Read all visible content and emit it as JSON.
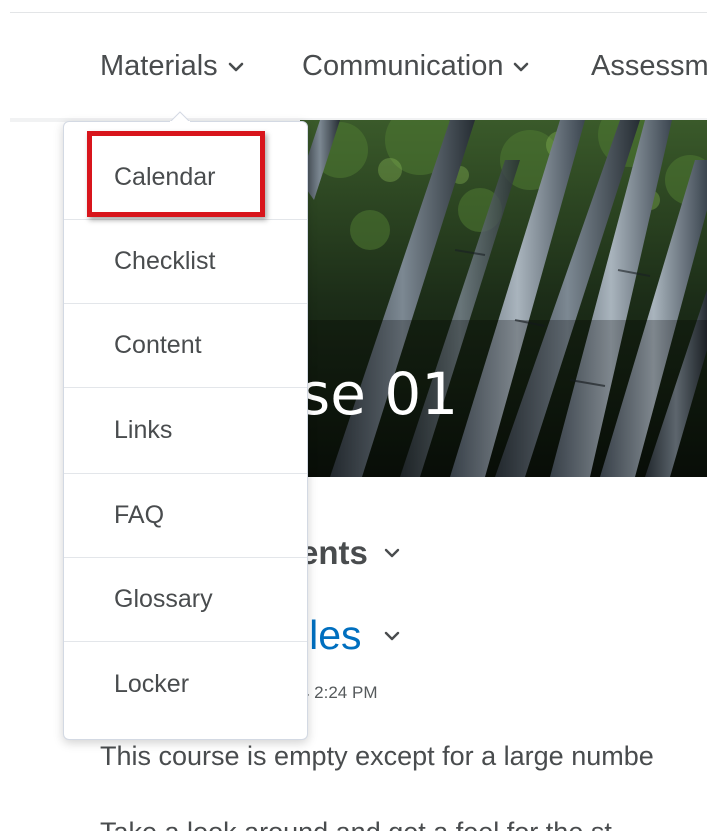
{
  "navbar": {
    "items": [
      {
        "label": "Materials",
        "has_menu": true
      },
      {
        "label": "Communication",
        "has_menu": true
      },
      {
        "label": "Assessm",
        "has_menu": false
      }
    ]
  },
  "hero": {
    "title_fragment": "se 01"
  },
  "content": {
    "section_title_fragment": "ents",
    "module_title_fragment": "iles",
    "timestamp_fragment": "4 2:24 PM",
    "body_line_1": "This course is empty except for a large numbe",
    "body_line_2": "Take a look around and get a feel for the st"
  },
  "dropdown": {
    "items": [
      {
        "label": "Calendar"
      },
      {
        "label": "Checklist"
      },
      {
        "label": "Content"
      },
      {
        "label": "Links"
      },
      {
        "label": "FAQ"
      },
      {
        "label": "Glossary"
      },
      {
        "label": "Locker"
      }
    ],
    "highlighted_item": "Calendar"
  },
  "colors": {
    "highlight": "#d8151c",
    "link": "#006fbf",
    "text": "#494c4e"
  },
  "icons": {
    "nav_chevron": "chevron-down-icon"
  }
}
